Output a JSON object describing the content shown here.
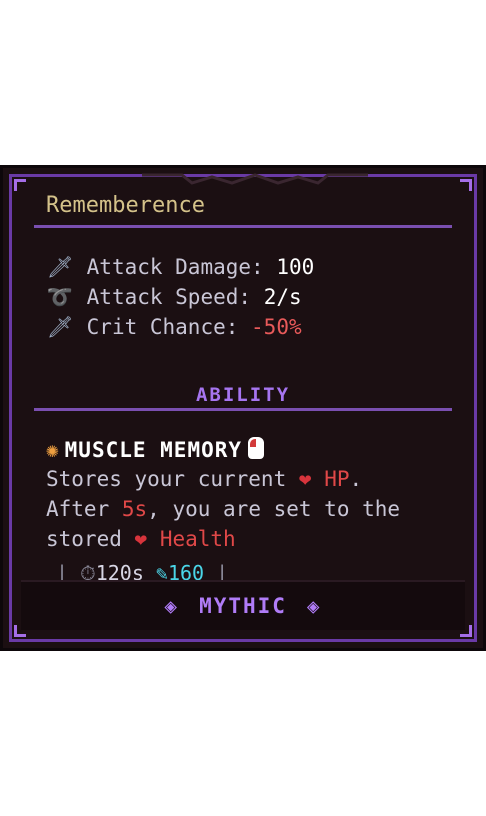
{
  "item": {
    "title": "Rememberence"
  },
  "stats": [
    {
      "icon": "sword-icon",
      "glyph": "🗡",
      "label": "Attack Damage:",
      "value": "100",
      "value_color": "#ffffff"
    },
    {
      "icon": "speed-icon",
      "glyph": "➰",
      "label": "Attack Speed:",
      "value": "2/s",
      "value_color": "#ffffff"
    },
    {
      "icon": "crit-icon",
      "glyph": "🗡",
      "label": "Crit Chance:",
      "value": "-50%",
      "value_color": "#e85a5a"
    }
  ],
  "ability": {
    "section_label": "ABILITY",
    "name": "MUSCLE MEMORY",
    "line1_prefix": "Stores your current",
    "line1_stat": "HP",
    "line1_suffix": ".",
    "line2_prefix": "After",
    "line2_time": "5s",
    "line2_suffix": ", you are set to the",
    "line3_prefix": "stored",
    "line3_stat": "Health",
    "cooldown": "120s",
    "mana": "160"
  },
  "rarity": {
    "label": "MYTHIC",
    "color": "#b07cf7"
  },
  "colors": {
    "background": "#1b0f12",
    "border": "#6a3aa6",
    "title": "#d4c28a",
    "negative": "#e85a5a",
    "health": "#e04848",
    "mana": "#4ad6e8"
  }
}
